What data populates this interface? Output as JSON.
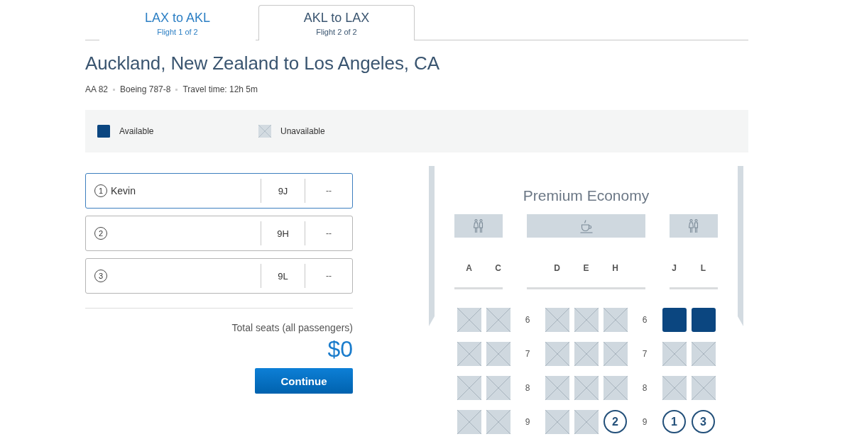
{
  "tabs": [
    {
      "route": "LAX to AKL",
      "subtitle": "Flight 1 of 2",
      "selected": false
    },
    {
      "route": "AKL to LAX",
      "subtitle": "Flight 2 of 2",
      "selected": true
    }
  ],
  "route_title": "Auckland, New Zealand to Los Angeles, CA",
  "flight_details": [
    "AA 82",
    "Boeing 787-8",
    "Travel time: 12h 5m"
  ],
  "legend": [
    {
      "kind": "available",
      "label": "Available"
    },
    {
      "kind": "unavailable",
      "label": "Unavailable"
    }
  ],
  "passengers": [
    {
      "number": "1",
      "name": "Kevin",
      "seat": "9J",
      "price": "--",
      "selected": true
    },
    {
      "number": "2",
      "seat": "9H",
      "price": "--",
      "selected": false
    },
    {
      "number": "3",
      "seat": "9L",
      "price": "--",
      "selected": false
    }
  ],
  "total": {
    "label": "Total seats (all passengers)",
    "amount": "$0"
  },
  "continue_button": "Continue",
  "seat_map": {
    "cabin_title": "Premium Economy",
    "facilities": [
      {
        "kind": "lavatory"
      },
      {
        "kind": "galley"
      },
      {
        "kind": "lavatory"
      }
    ],
    "column_letters": [
      "A",
      "C",
      "D",
      "E",
      "H",
      "J",
      "L"
    ],
    "rows": [
      {
        "cells": [
          {
            "kind": "unavailable"
          },
          {
            "kind": "unavailable"
          },
          {
            "kind": "row_number",
            "text": "6"
          },
          {
            "kind": "unavailable"
          },
          {
            "kind": "unavailable"
          },
          {
            "kind": "unavailable"
          },
          {
            "kind": "row_number",
            "text": "6"
          },
          {
            "kind": "available"
          },
          {
            "kind": "available"
          }
        ]
      },
      {
        "cells": [
          {
            "kind": "unavailable"
          },
          {
            "kind": "unavailable"
          },
          {
            "kind": "row_number",
            "text": "7"
          },
          {
            "kind": "unavailable"
          },
          {
            "kind": "unavailable"
          },
          {
            "kind": "unavailable"
          },
          {
            "kind": "row_number",
            "text": "7"
          },
          {
            "kind": "unavailable"
          },
          {
            "kind": "unavailable"
          }
        ]
      },
      {
        "cells": [
          {
            "kind": "unavailable"
          },
          {
            "kind": "unavailable"
          },
          {
            "kind": "row_number",
            "text": "8"
          },
          {
            "kind": "unavailable"
          },
          {
            "kind": "unavailable"
          },
          {
            "kind": "unavailable"
          },
          {
            "kind": "row_number",
            "text": "8"
          },
          {
            "kind": "unavailable"
          },
          {
            "kind": "unavailable"
          }
        ]
      },
      {
        "cells": [
          {
            "kind": "unavailable"
          },
          {
            "kind": "unavailable"
          },
          {
            "kind": "row_number",
            "text": "9"
          },
          {
            "kind": "unavailable"
          },
          {
            "kind": "unavailable"
          },
          {
            "kind": "assigned",
            "text": "2"
          },
          {
            "kind": "row_number",
            "text": "9"
          },
          {
            "kind": "assigned",
            "text": "1"
          },
          {
            "kind": "assigned",
            "text": "3"
          }
        ]
      }
    ]
  }
}
